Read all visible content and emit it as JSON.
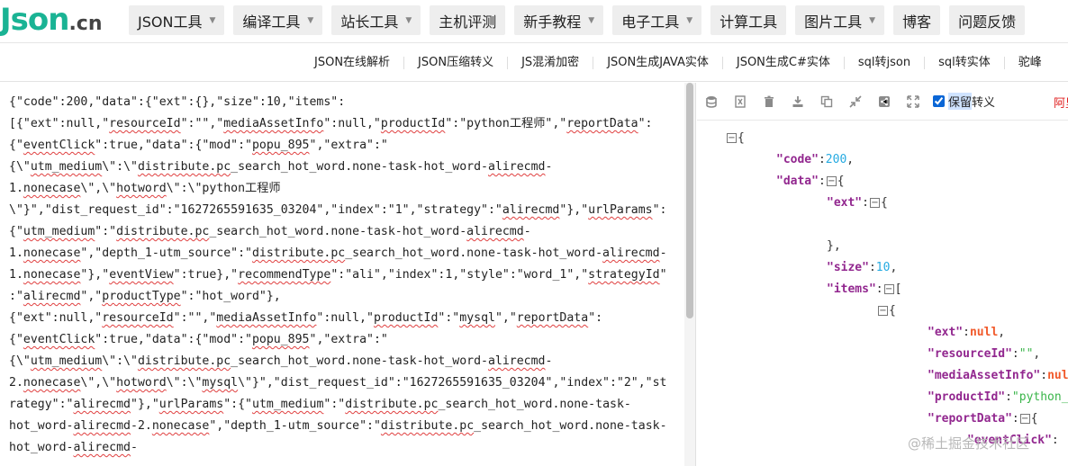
{
  "logo": {
    "main": "Json",
    "suffix": ".cn"
  },
  "nav": [
    {
      "label": "JSON工具",
      "caret": "▼"
    },
    {
      "label": "编译工具",
      "caret": "▼"
    },
    {
      "label": "站长工具",
      "caret": "▼"
    },
    {
      "label": "主机评测",
      "caret": ""
    },
    {
      "label": "新手教程",
      "caret": "▼"
    },
    {
      "label": "电子工具",
      "caret": "▼"
    },
    {
      "label": "计算工具",
      "caret": ""
    },
    {
      "label": "图片工具",
      "caret": "▼"
    },
    {
      "label": "博客",
      "caret": ""
    },
    {
      "label": "问题反馈",
      "caret": ""
    }
  ],
  "subnav": [
    "JSON在线解析",
    "JSON压缩转义",
    "JS混淆加密",
    "JSON生成JAVA实体",
    "JSON生成C#实体",
    "sql转json",
    "sql转实体",
    "驼峰"
  ],
  "raw_text": "{\"code\":200,\"data\":{\"ext\":{},\"size\":10,\"items\":\n[{\"ext\":null,\"resourceId\":\"\",\"mediaAssetInfo\":null,\"productId\":\"python工程师\",\"reportData\":\n{\"eventClick\":true,\"data\":{\"mod\":\"popu_895\",\"extra\":\"\n{\\\"utm_medium\\\":\\\"distribute.pc_search_hot_word.none-task-hot_word-alirecmd-\n1.nonecase\\\",\\\"hotword\\\":\\\"python工程师\n\\\"}\",\"dist_request_id\":\"1627265591635_03204\",\"index\":\"1\",\"strategy\":\"alirecmd\"},\"urlParams\":\n{\"utm_medium\":\"distribute.pc_search_hot_word.none-task-hot_word-alirecmd-\n1.nonecase\",\"depth_1-utm_source\":\"distribute.pc_search_hot_word.none-task-hot_word-alirecmd-\n1.nonecase\"},\"eventView\":true},\"recommendType\":\"ali\",\"index\":1,\"style\":\"word_1\",\"strategyId\"\n:\"alirecmd\",\"productType\":\"hot_word\"},\n{\"ext\":null,\"resourceId\":\"\",\"mediaAssetInfo\":null,\"productId\":\"mysql\",\"reportData\":\n{\"eventClick\":true,\"data\":{\"mod\":\"popu_895\",\"extra\":\"\n{\\\"utm_medium\\\":\\\"distribute.pc_search_hot_word.none-task-hot_word-alirecmd-\n2.nonecase\\\",\\\"hotword\\\":\\\"mysql\\\"}\",\"dist_request_id\":\"1627265591635_03204\",\"index\":\"2\",\"st\nrategy\":\"alirecmd\"},\"urlParams\":{\"utm_medium\":\"distribute.pc_search_hot_word.none-task-\nhot_word-alirecmd-2.nonecase\",\"depth_1-utm_source\":\"distribute.pc_search_hot_word.none-task-\nhot_word-alirecmd-",
  "toolbar": {
    "icons": [
      "database-icon",
      "excel-icon",
      "trash-icon",
      "download-icon",
      "copy-icon",
      "compress-icon",
      "share-icon",
      "expand-icon"
    ],
    "keep_label_a": "保留",
    "keep_label_b": "转义",
    "keep_checked": true,
    "more_label": "阿里"
  },
  "tree": {
    "rows": [
      {
        "toggle": "⊟",
        "parts": [
          [
            "p",
            "{"
          ]
        ]
      },
      {
        "toggle": "",
        "parts": [
          [
            "k",
            "\"code\""
          ],
          [
            "p",
            ":"
          ],
          [
            "n",
            "200"
          ],
          [
            "p",
            ","
          ]
        ]
      },
      {
        "toggle": "⊟",
        "parts": [
          [
            "k",
            "\"data\""
          ],
          [
            "p",
            ":"
          ],
          [
            "t",
            "⊟"
          ],
          [
            "p",
            "{"
          ]
        ]
      },
      {
        "toggle": "⊟",
        "parts": [
          [
            "k",
            "\"ext\""
          ],
          [
            "p",
            ":"
          ],
          [
            "t",
            "⊟"
          ],
          [
            "p",
            "{"
          ]
        ]
      },
      {
        "toggle": "",
        "parts": [
          [
            "p",
            ""
          ]
        ]
      },
      {
        "toggle": "",
        "parts": [
          [
            "p",
            "},"
          ]
        ]
      },
      {
        "toggle": "",
        "parts": [
          [
            "k",
            "\"size\""
          ],
          [
            "p",
            ":"
          ],
          [
            "n",
            "10"
          ],
          [
            "p",
            ","
          ]
        ]
      },
      {
        "toggle": "",
        "parts": [
          [
            "k",
            "\"items\""
          ],
          [
            "p",
            ":"
          ],
          [
            "t",
            "⊟"
          ],
          [
            "p",
            "["
          ]
        ]
      },
      {
        "toggle": "",
        "parts": [
          [
            "t",
            "⊟"
          ],
          [
            "p",
            "{"
          ]
        ]
      },
      {
        "toggle": "",
        "parts": [
          [
            "k",
            "\"ext\""
          ],
          [
            "p",
            ":"
          ],
          [
            "nl",
            "null"
          ],
          [
            "p",
            ","
          ]
        ]
      },
      {
        "toggle": "",
        "parts": [
          [
            "k",
            "\"resourceId\""
          ],
          [
            "p",
            ":"
          ],
          [
            "s",
            "\"\""
          ],
          [
            "p",
            ","
          ]
        ]
      },
      {
        "toggle": "",
        "parts": [
          [
            "k",
            "\"mediaAssetInfo\""
          ],
          [
            "p",
            ":"
          ],
          [
            "nl",
            "null"
          ]
        ]
      },
      {
        "toggle": "",
        "parts": [
          [
            "k",
            "\"productId\""
          ],
          [
            "p",
            ":"
          ],
          [
            "s",
            "\"python_"
          ]
        ]
      },
      {
        "toggle": "",
        "parts": [
          [
            "k",
            "\"reportData\""
          ],
          [
            "p",
            ":"
          ],
          [
            "t",
            "⊟"
          ],
          [
            "p",
            "{"
          ]
        ]
      },
      {
        "toggle": "",
        "parts": [
          [
            "k",
            "\"eventClick\""
          ],
          [
            "p",
            ":"
          ]
        ]
      }
    ]
  },
  "watermark": "@稀土掘金技术社区"
}
